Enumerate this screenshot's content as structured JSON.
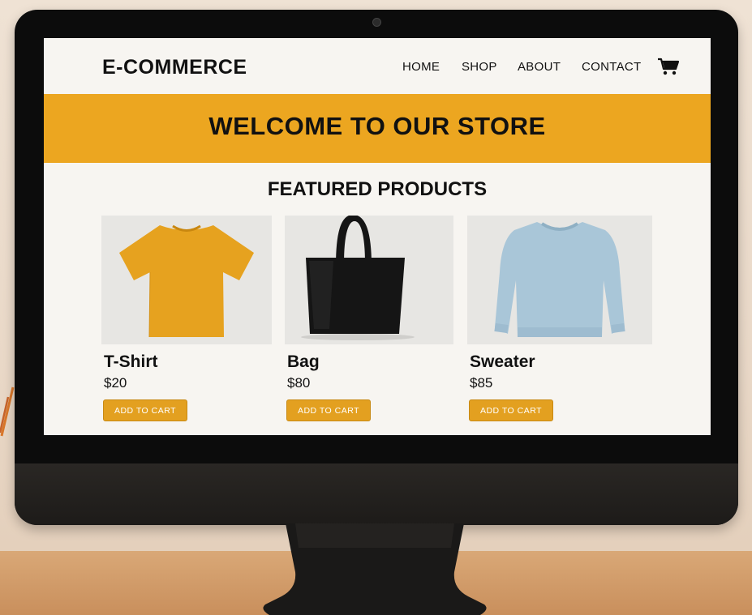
{
  "site": {
    "logo": "E-COMMERCE"
  },
  "nav": {
    "items": [
      {
        "label": "HOME"
      },
      {
        "label": "SHOP"
      },
      {
        "label": "ABOUT"
      },
      {
        "label": "CONTACT"
      }
    ],
    "cart_icon": "shopping-cart-icon"
  },
  "banner": {
    "title": "WELCOME TO OUR STORE",
    "color": "#eca620"
  },
  "featured": {
    "title": "FEATURED PRODUCTS",
    "products": [
      {
        "name": "T-Shirt",
        "price": "$20",
        "button": "ADD TO CART",
        "image": "orange t-shirt",
        "color": "#e6a21f"
      },
      {
        "name": "Bag",
        "price": "$80",
        "button": "ADD TO CART",
        "image": "black tote bag",
        "color": "#151515"
      },
      {
        "name": "Sweater",
        "price": "$85",
        "button": "ADD TO CART",
        "image": "light blue sweater",
        "color": "#a9c6d8"
      }
    ]
  },
  "colors": {
    "accent": "#eca620",
    "button": "#e3a020",
    "page_bg": "#f7f5f1"
  }
}
